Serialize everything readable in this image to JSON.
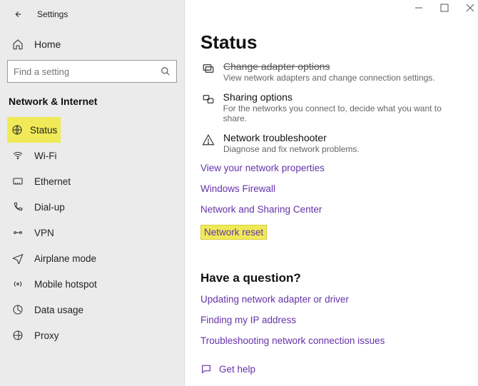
{
  "header": {
    "app_title": "Settings"
  },
  "home": {
    "label": "Home"
  },
  "search": {
    "placeholder": "Find a setting"
  },
  "section_title": "Network & Internet",
  "sidebar": {
    "items": [
      {
        "label": "Status"
      },
      {
        "label": "Wi-Fi"
      },
      {
        "label": "Ethernet"
      },
      {
        "label": "Dial-up"
      },
      {
        "label": "VPN"
      },
      {
        "label": "Airplane mode"
      },
      {
        "label": "Mobile hotspot"
      },
      {
        "label": "Data usage"
      },
      {
        "label": "Proxy"
      }
    ]
  },
  "main": {
    "title": "Status",
    "items": [
      {
        "title": "Change adapter options",
        "desc": "View network adapters and change connection settings."
      },
      {
        "title": "Sharing options",
        "desc": "For the networks you connect to, decide what you want to share."
      },
      {
        "title": "Network troubleshooter",
        "desc": "Diagnose and fix network problems."
      }
    ],
    "links": [
      "View your network properties",
      "Windows Firewall",
      "Network and Sharing Center",
      "Network reset"
    ],
    "question": {
      "title": "Have a question?",
      "links": [
        "Updating network adapter or driver",
        "Finding my IP address",
        "Troubleshooting network connection issues"
      ]
    },
    "get_help": "Get help"
  }
}
